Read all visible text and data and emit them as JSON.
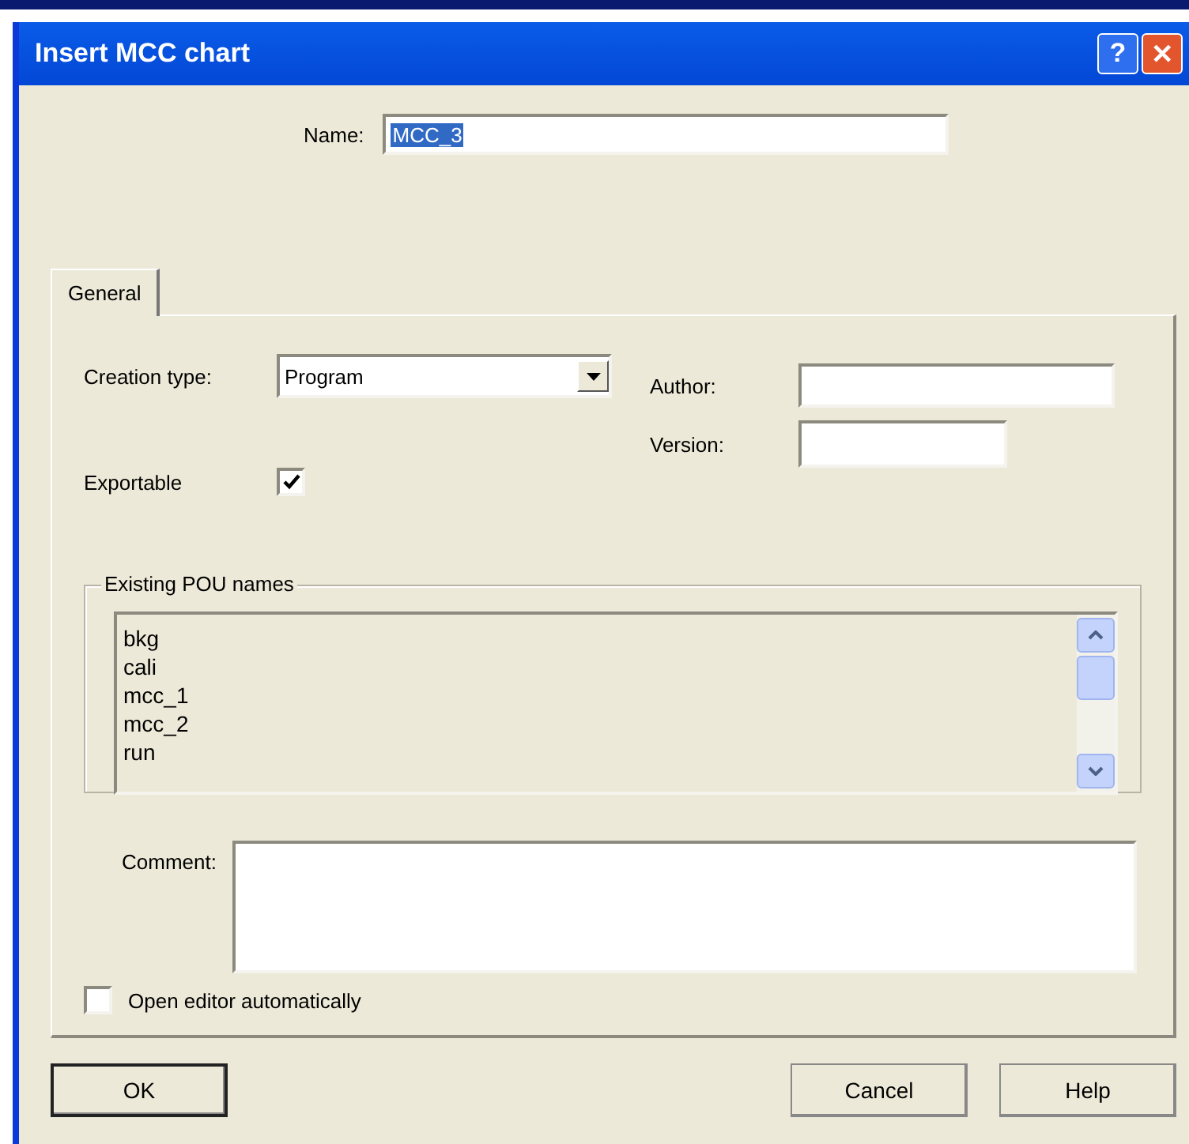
{
  "window": {
    "title": "Insert MCC chart"
  },
  "title_buttons": [
    {
      "kind": "help",
      "label": "?"
    },
    {
      "kind": "close",
      "label": "✕"
    }
  ],
  "name": {
    "label": "Name:",
    "value": "MCC_3",
    "selected": true
  },
  "tabs": [
    {
      "label": "General",
      "selected": true
    }
  ],
  "creation_type": {
    "label": "Creation type:",
    "value": "Program"
  },
  "author": {
    "label": "Author:"
  },
  "version": {
    "label": "Version:"
  },
  "exportable": {
    "label": "Exportable",
    "checked": true
  },
  "existing": {
    "title": "Existing POU names",
    "items": [
      "bkg",
      "cali",
      "mcc_1",
      "mcc_2",
      "run"
    ]
  },
  "comment": {
    "label": "Comment:"
  },
  "open_editor": {
    "label": "Open editor automatically",
    "checked": false
  },
  "buttons": [
    {
      "label": "OK",
      "default": true
    },
    {
      "label": "Cancel",
      "default": false
    },
    {
      "label": "Help",
      "default": false
    }
  ]
}
